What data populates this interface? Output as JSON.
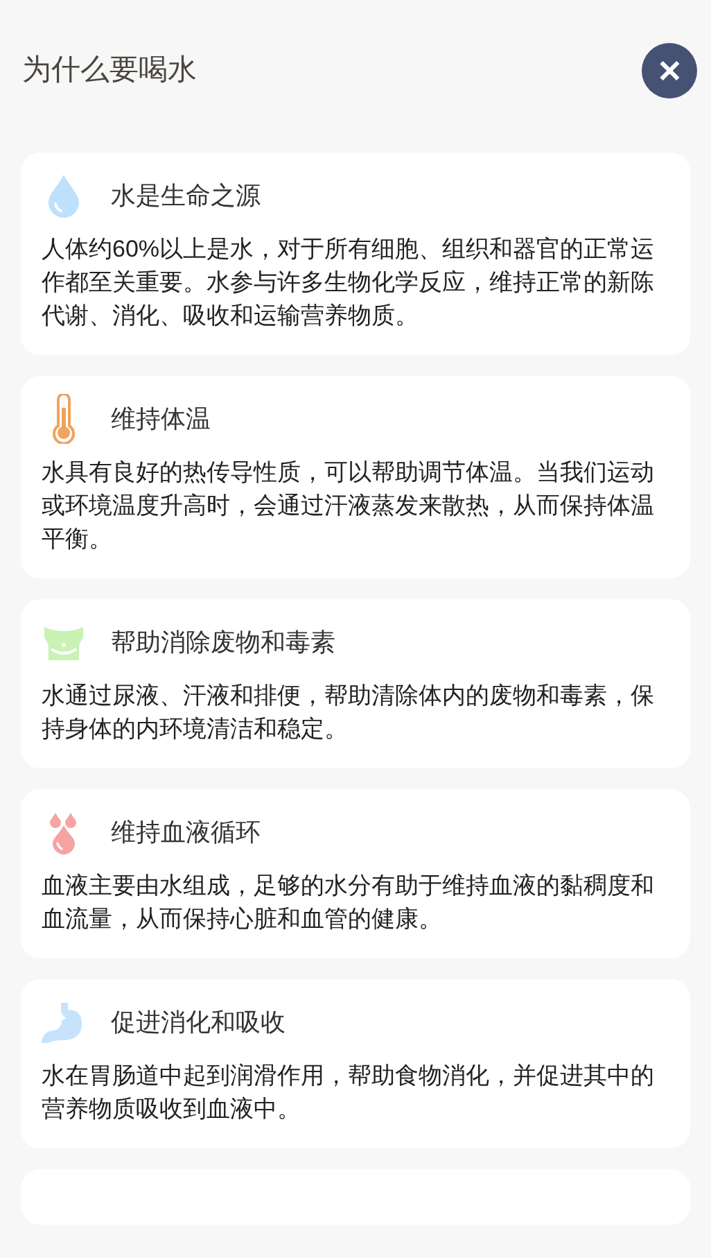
{
  "header": {
    "title": "为什么要喝水",
    "close": "✕"
  },
  "cards": [
    {
      "kind": "drop",
      "title": "水是生命之源",
      "body": "人体约60%以上是水，对于所有细胞、组织和器官的正常运作都至关重要。水参与许多生物化学反应，维持正常的新陈代谢、消化、吸收和运输营养物质。"
    },
    {
      "kind": "thermometer",
      "title": "维持体温",
      "body": "水具有良好的热传导性质，可以帮助调节体温。当我们运动或环境温度升高时，会通过汗液蒸发来散热，从而保持体温平衡。"
    },
    {
      "kind": "belly",
      "title": "帮助消除废物和毒素",
      "body": "水通过尿液、汗液和排便，帮助清除体内的废物和毒素，保持身体的内环境清洁和稳定。"
    },
    {
      "kind": "blood",
      "title": "维持血液循环",
      "body": "血液主要由水组成，足够的水分有助于维持血液的黏稠度和血流量，从而保持心脏和血管的健康。"
    },
    {
      "kind": "stomach",
      "title": "促进消化和吸收",
      "body": "水在胃肠道中起到润滑作用，帮助食物消化，并促进其中的营养物质吸收到血液中。"
    }
  ]
}
